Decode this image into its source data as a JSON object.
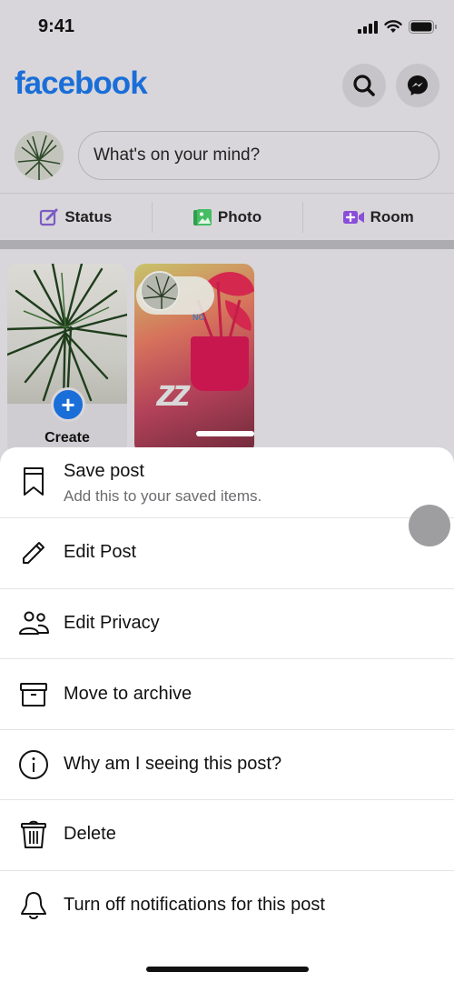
{
  "status_bar": {
    "time": "9:41",
    "icons": [
      "cellular-signal-icon",
      "wifi-icon",
      "battery-icon"
    ]
  },
  "header": {
    "logo": "facebook",
    "brand_color": "#1a6ed8",
    "buttons": [
      {
        "name": "search",
        "icon": "search-icon"
      },
      {
        "name": "messenger",
        "icon": "messenger-icon"
      }
    ]
  },
  "composer": {
    "placeholder": "What's on your mind?"
  },
  "actions": [
    {
      "label": "Status",
      "icon": "edit-square-icon",
      "color": "#7b5bc4"
    },
    {
      "label": "Photo",
      "icon": "photo-icon",
      "color": "#45bd62"
    },
    {
      "label": "Room",
      "icon": "video-plus-icon",
      "color": "#8a4fd8"
    }
  ],
  "stories": {
    "create_label": "Create",
    "story_2": {
      "sticker_text": "NO"
    }
  },
  "sheet": {
    "items": [
      {
        "label": "Save post",
        "sublabel": "Add this to your saved items.",
        "icon": "bookmark-icon"
      },
      {
        "label": "Edit Post",
        "icon": "pencil-icon"
      },
      {
        "label": "Edit Privacy",
        "icon": "people-icon"
      },
      {
        "label": "Move to archive",
        "icon": "archive-box-icon"
      },
      {
        "label": "Why am I seeing this post?",
        "icon": "info-circle-icon"
      },
      {
        "label": "Delete",
        "icon": "trash-icon"
      },
      {
        "label": "Turn off notifications for this post",
        "icon": "bell-icon"
      }
    ]
  }
}
